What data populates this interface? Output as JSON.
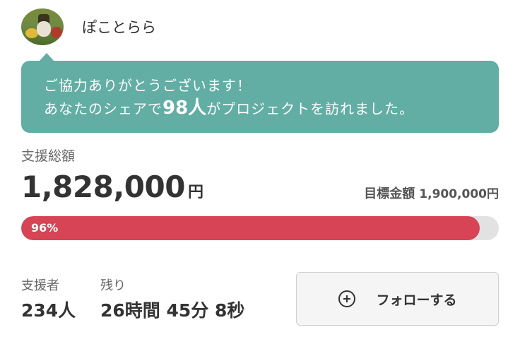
{
  "user": {
    "name": "ぽことらら",
    "avatar_icon": "dog-photo-avatar"
  },
  "share_message": {
    "line1": "ご協力ありがとうございます！",
    "line2_prefix": "あなたのシェアで",
    "visitors": "98人",
    "line2_suffix": "がプロジェクトを訪れました。"
  },
  "funding": {
    "total_label": "支援総額",
    "total_amount": "1,828,000",
    "currency": "円",
    "goal_label": "目標金額",
    "goal_amount": "1,900,000円",
    "progress_percent": 96,
    "progress_label": "96%"
  },
  "stats": {
    "supporters_label": "支援者",
    "supporters_value": "234人",
    "remaining_label": "残り",
    "remaining_value": "26時間 45分 8秒"
  },
  "follow_button": {
    "label": "フォローする",
    "icon": "plus-circle-icon"
  },
  "colors": {
    "bubble": "#62ada4",
    "progress": "#d64455",
    "track": "#e2e2e2"
  }
}
